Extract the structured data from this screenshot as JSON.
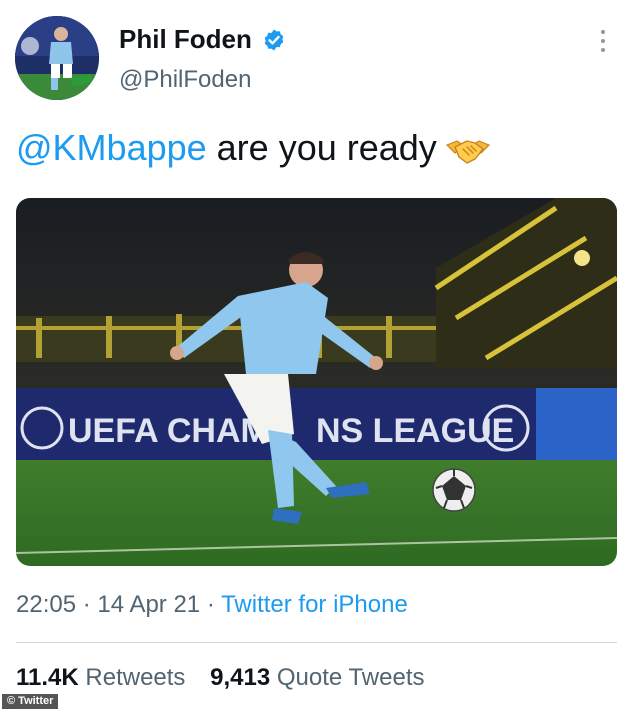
{
  "user": {
    "display_name": "Phil Foden",
    "handle": "@PhilFoden",
    "verified_icon": "verified-badge-icon",
    "avatar_icon": "avatar"
  },
  "tweet": {
    "mention": "@KMbappe",
    "text": " are you ready",
    "emoji": "handshake-emoji"
  },
  "media": {
    "banner_text_left": "UEFA CHAMP",
    "banner_text_right": "NS LEAGUE"
  },
  "meta": {
    "time": "22:05",
    "separator": "·",
    "date": "14 Apr 21",
    "source": "Twitter for iPhone"
  },
  "stats": {
    "retweets_count": "11.4K",
    "retweets_label": "Retweets",
    "quotes_count": "9,413",
    "quotes_label": "Quote Tweets"
  },
  "credit": "© Twitter",
  "colors": {
    "link": "#1d9bf0",
    "secondary_text": "#536471",
    "primary_text": "#0f1419"
  }
}
